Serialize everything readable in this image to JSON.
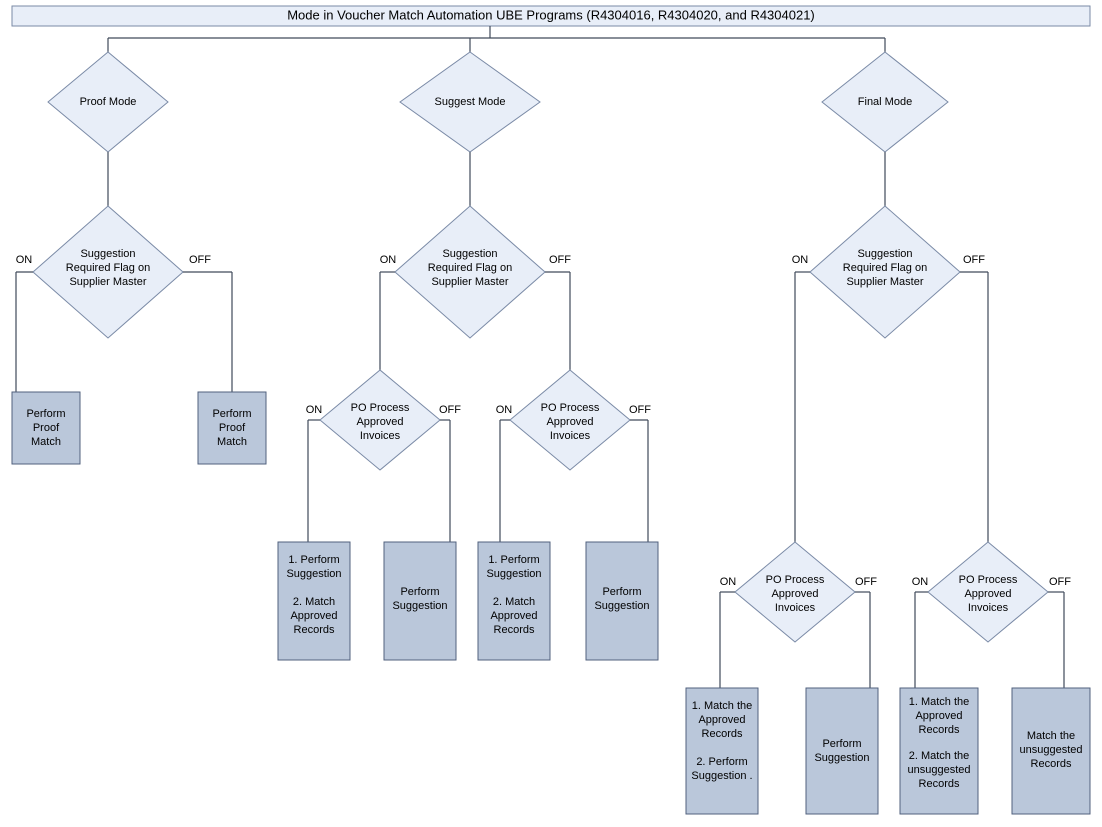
{
  "title": "Mode in Voucher Match Automation UBE Programs (R4304016, R4304020, and R4304021)",
  "labels": {
    "on": "ON",
    "off": "OFF",
    "suggestionFlag1": "Suggestion",
    "suggestionFlag2": "Required Flag on",
    "suggestionFlag3": "Supplier Master",
    "poProcess1": "PO Process",
    "poProcess2": "Approved",
    "poProcess3": "Invoices"
  },
  "modes": {
    "proof": "Proof Mode",
    "suggest": "Suggest Mode",
    "final": "Final Mode"
  },
  "actions": {
    "performProofMatch1": "Perform",
    "performProofMatch2": "Proof",
    "performProofMatch3": "Match",
    "suggestOnOn1": "1. Perform",
    "suggestOnOn2": "Suggestion",
    "suggestOnOn3": "2. Match",
    "suggestOnOn4": "Approved",
    "suggestOnOn5": "Records",
    "performSuggestion1": "Perform",
    "performSuggestion2": "Suggestion",
    "finalA1": "1. Match the",
    "finalA2": "Approved",
    "finalA3": "Records",
    "finalA4": "2. Perform",
    "finalA5": "Suggestion .",
    "finalC1": "1. Match the",
    "finalC2": "Approved",
    "finalC3": "Records",
    "finalC4": "2. Match the",
    "finalC5": "unsuggested",
    "finalC6": "Records",
    "finalD1": "Match the",
    "finalD2": "unsuggested",
    "finalD3": "Records"
  }
}
